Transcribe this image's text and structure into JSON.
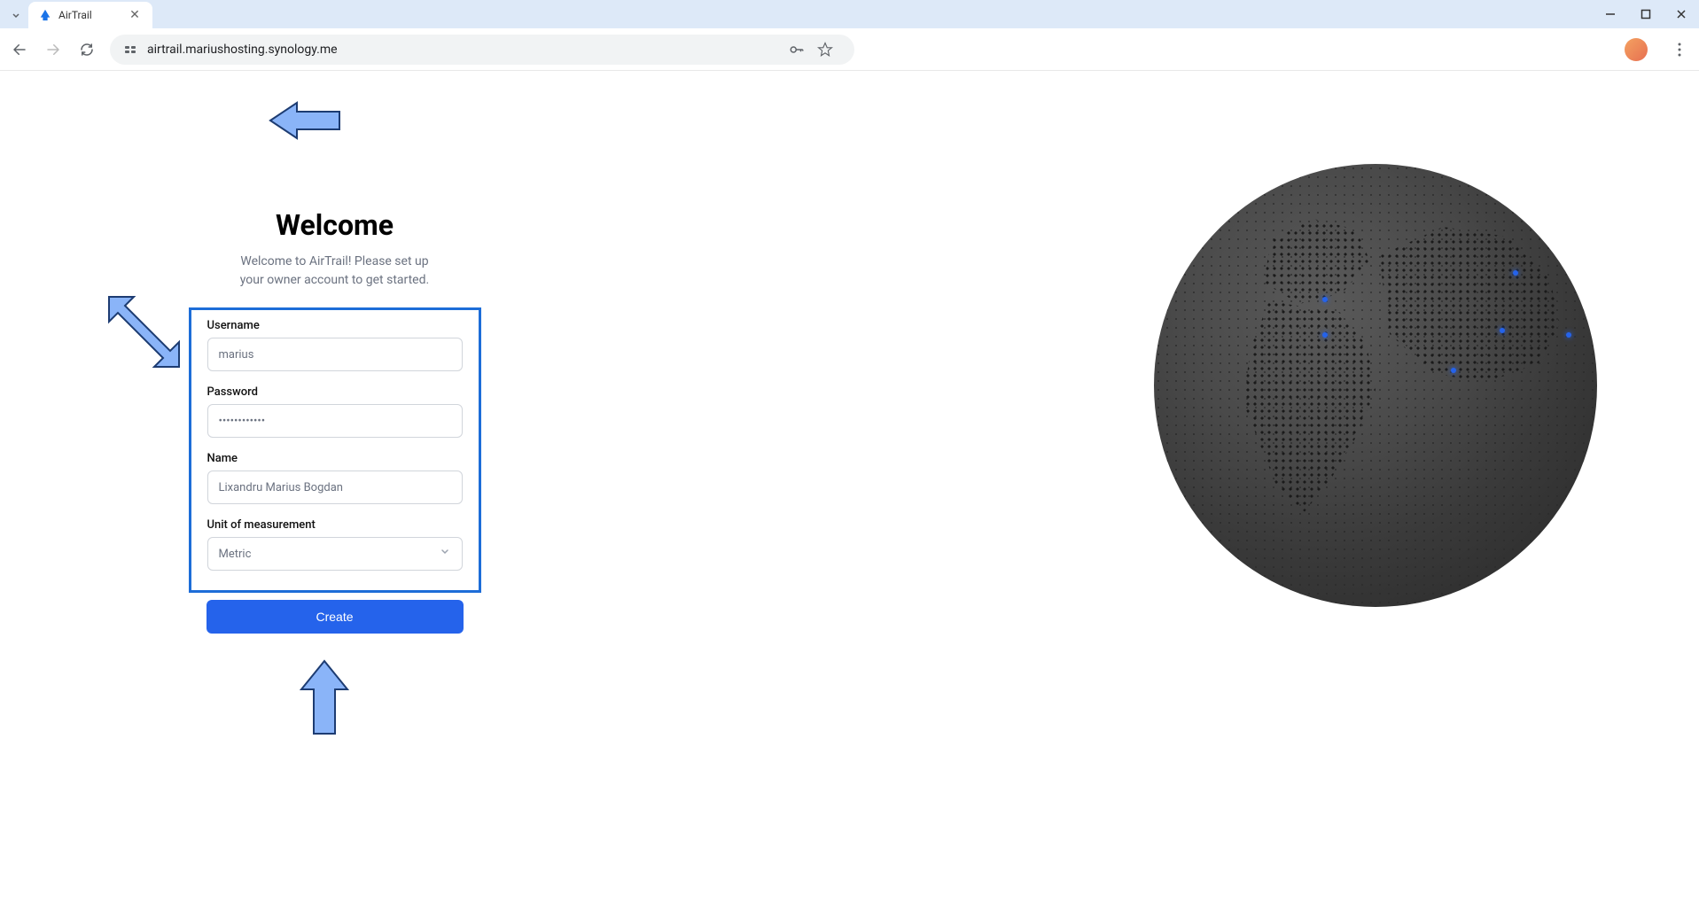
{
  "browser": {
    "tab_title": "AirTrail",
    "url": "airtrail.mariushosting.synology.me"
  },
  "setup": {
    "heading": "Welcome",
    "subtext_line1": "Welcome to AirTrail! Please set up",
    "subtext_line2": "your owner account to get started.",
    "fields": {
      "username": {
        "label": "Username",
        "value": "marius"
      },
      "password": {
        "label": "Password",
        "value": "••••••••••••"
      },
      "name": {
        "label": "Name",
        "value": "Lixandru Marius Bogdan"
      },
      "unit": {
        "label": "Unit of measurement",
        "value": "Metric"
      }
    },
    "submit_label": "Create"
  },
  "globe_markers": [
    {
      "x": 38,
      "y": 30
    },
    {
      "x": 38,
      "y": 38
    },
    {
      "x": 81,
      "y": 24
    },
    {
      "x": 67,
      "y": 46
    },
    {
      "x": 78,
      "y": 37
    },
    {
      "x": 93,
      "y": 38
    }
  ]
}
